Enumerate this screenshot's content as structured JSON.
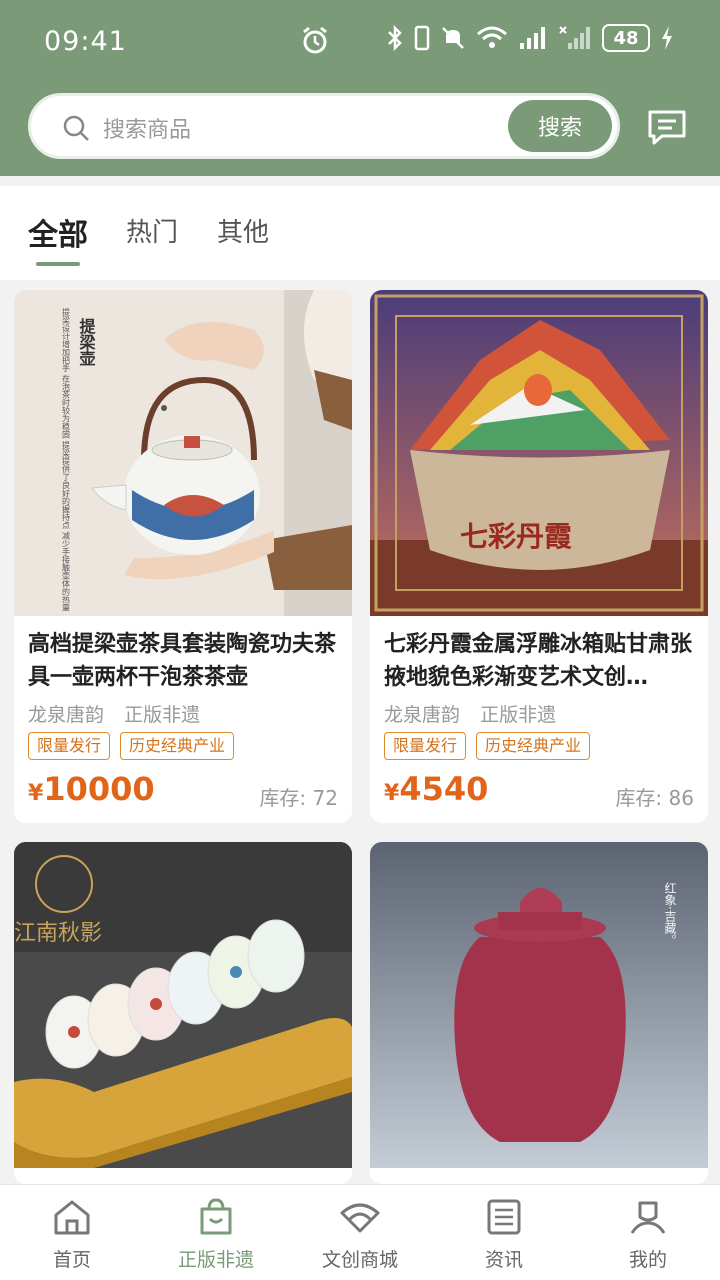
{
  "status": {
    "time": "09:41",
    "battery": "48"
  },
  "search": {
    "placeholder": "搜索商品",
    "button": "搜索"
  },
  "tabs": [
    "全部",
    "热门",
    "其他"
  ],
  "products": [
    {
      "title": "高档提梁壶茶具套装陶瓷功夫茶具一壶两杯干泡茶茶壶",
      "brand": "龙泉唐韵",
      "auth": "正版非遗",
      "tags": [
        "限量发行",
        "历史经典产业"
      ],
      "currency": "¥",
      "price": "10000",
      "stock_label": "库存:",
      "stock": "72",
      "image_text": {
        "title": "提梁壶",
        "desc": "提梁设计增加把手 在泡茶时较为稳固 提梁提供了良好的握持点 减少手接触壶体的热量"
      }
    },
    {
      "title": "七彩丹霞金属浮雕冰箱贴甘肃张掖地貌色彩渐变艺术文创…",
      "brand": "龙泉唐韵",
      "auth": "正版非遗",
      "tags": [
        "限量发行",
        "历史经典产业"
      ],
      "currency": "¥",
      "price": "4540",
      "stock_label": "库存:",
      "stock": "86",
      "image_text": {
        "title": "七彩丹霞"
      }
    },
    {
      "image_text": {
        "logo": "江南秋影"
      }
    },
    {
      "image_text": {
        "caption": "红象·吉藏。"
      }
    }
  ],
  "nav": [
    "首页",
    "正版非遗",
    "文创商城",
    "资讯",
    "我的"
  ],
  "colors": {
    "primary": "#7a9a78",
    "price": "#e0641a",
    "badge": "#e08a2e"
  }
}
